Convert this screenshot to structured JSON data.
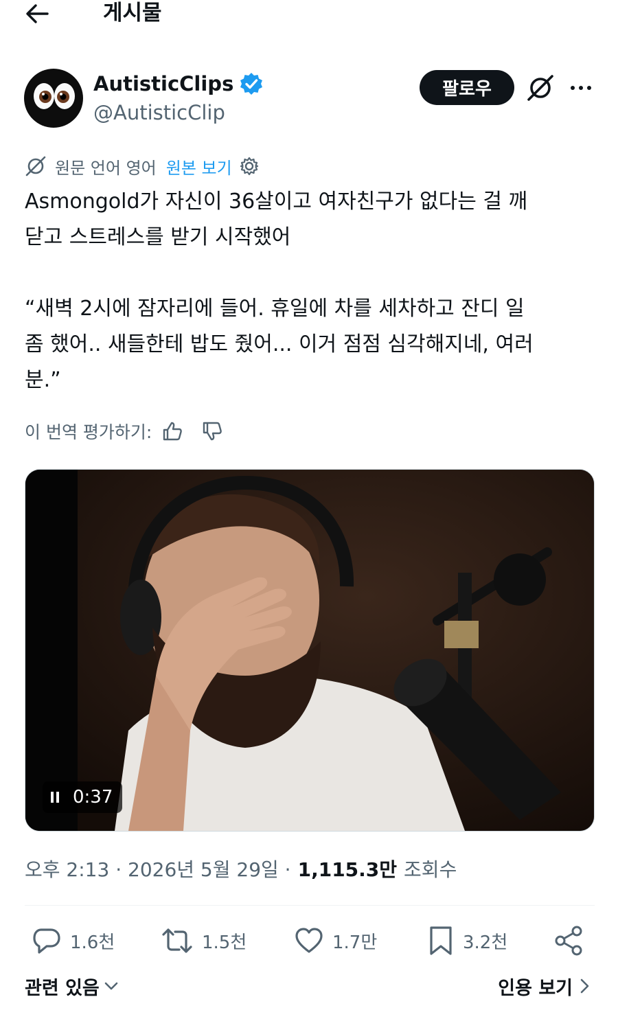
{
  "header": {
    "title": "게시물",
    "back_icon": "arrow-left-icon"
  },
  "author": {
    "name": "AutisticClips",
    "handle": "@AutisticClip",
    "verified": true,
    "follow_label": "팔로우"
  },
  "translation": {
    "source_text": "원문 언어 영어",
    "show_original": "원본 보기"
  },
  "tweet": {
    "text": "Asmongold가 자신이 36살이고 여자친구가 없다는 걸 깨\n닫고 스트레스를 받기 시작했어\n\n“새벽 2시에 잠자리에 들어. 휴일에 차를 세차하고 잔디 일\n좀 했어.. 새들한테 밥도 줬어... 이거 점점 심각해지네, 여러\n분.”"
  },
  "rate": {
    "label": "이 번역 평가하기:"
  },
  "media": {
    "duration": "0:37",
    "state": "playing"
  },
  "meta": {
    "time": "오후 2:13 · 2026년 5월 29일 ·",
    "views": "1,115.3만",
    "views_label": "조회수"
  },
  "actions": {
    "replies": "1.6천",
    "reposts": "1.5천",
    "likes": "1.7만",
    "bookmarks": "3.2천"
  },
  "footer": {
    "related": "관련 있음",
    "quotes": "인용 보기"
  },
  "colors": {
    "accent": "#1d9bf0",
    "text": "#0f1419",
    "secondary": "#536471"
  }
}
